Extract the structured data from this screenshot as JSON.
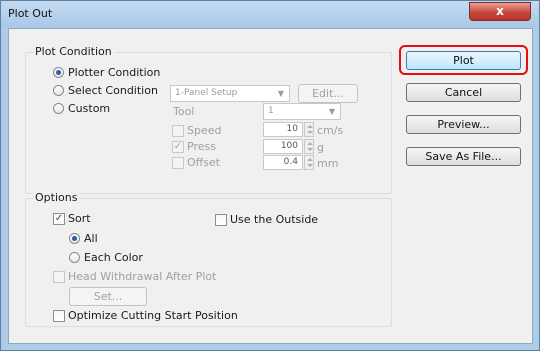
{
  "window": {
    "title": "Plot Out",
    "close_glyph": "x"
  },
  "plot_condition": {
    "group_title": "Plot Condition",
    "plotter_condition_label": "Plotter Condition",
    "select_condition_label": "Select Condition",
    "custom_label": "Custom",
    "setup_value": "1-Panel Setup",
    "edit_label": "Edit...",
    "tool_label": "Tool",
    "tool_value": "1",
    "speed_label": "Speed",
    "speed_value": "10",
    "speed_unit": "cm/s",
    "press_label": "Press",
    "press_value": "100",
    "press_unit": "g",
    "offset_label": "Offset",
    "offset_value": "0.4",
    "offset_unit": "mm"
  },
  "options": {
    "group_title": "Options",
    "sort_label": "Sort",
    "use_outside_label": "Use the Outside",
    "all_label": "All",
    "each_color_label": "Each Color",
    "head_withdrawal_label": "Head Withdrawal After Plot",
    "set_label": "Set...",
    "optimize_label": "Optimize Cutting Start Position"
  },
  "buttons": {
    "plot": "Plot",
    "cancel": "Cancel",
    "preview": "Preview...",
    "save_as_file": "Save As File..."
  },
  "check_glyph": "✓",
  "colors": {
    "highlight": "#e01010",
    "title_bar": "#aecbe8",
    "close_button": "#c6473a"
  }
}
